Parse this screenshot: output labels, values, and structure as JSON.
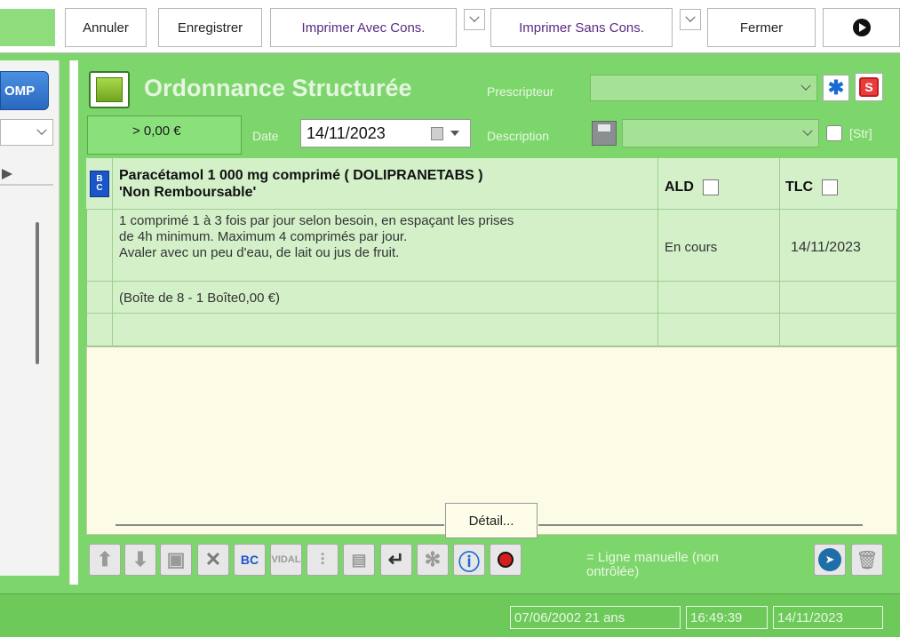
{
  "toolbar": {
    "annuler": "Annuler",
    "enregistrer": "Enregistrer",
    "imprimer_avec": "Imprimer Avec Cons.",
    "imprimer_sans": "Imprimer Sans Cons.",
    "fermer": "Fermer"
  },
  "left": {
    "comp_label": "OMP"
  },
  "header": {
    "title": "Ordonnance Structurée",
    "prescripteur_label": "Prescripteur",
    "amount": "> 0,00 €",
    "date_label": "Date",
    "date_value": "14/11/2023",
    "description_label": "Description",
    "str_label": "[Str]"
  },
  "grid": {
    "drug_line1": "Paracétamol 1 000 mg comprimé ( DOLIPRANETABS )",
    "drug_line2": "'Non Remboursable'",
    "col_ald": "ALD",
    "col_tlc": "TLC",
    "posology_line1": "1 comprimé 1 à 3 fois par jour selon besoin, en espaçant les prises",
    "posology_line2": "de 4h minimum. Maximum 4 comprimés par jour.",
    "posology_line3": "Avaler avec un peu d'eau, de lait ou jus de fruit.",
    "status": "En cours",
    "status_date": "14/11/2023",
    "packaging": "(Boîte de 8 - 1 Boîte0,00 €)"
  },
  "detail_button": "Détail...",
  "legend": {
    "line1": "= Ligne manuelle (non",
    "line2": "ontrôlée)"
  },
  "status": {
    "birth": "07/06/2002 21 ans",
    "time": "16:49:39",
    "date": "14/11/2023"
  }
}
